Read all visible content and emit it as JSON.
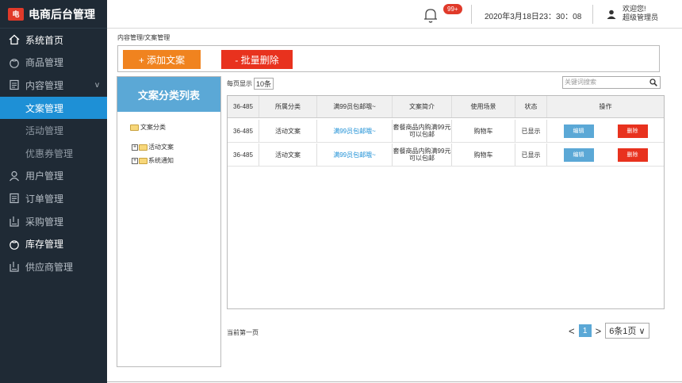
{
  "app": {
    "title": "电商后台管理",
    "logo_glyph": "电"
  },
  "sidebar": {
    "items": [
      {
        "label": "系统首页",
        "icon": "home-icon"
      },
      {
        "label": "商品管理",
        "icon": "gift-icon"
      },
      {
        "label": "内容管理",
        "icon": "document-icon"
      },
      {
        "label": "文案管理"
      },
      {
        "label": "活动管理"
      },
      {
        "label": "优惠券管理"
      },
      {
        "label": "用户管理",
        "icon": "user-icon"
      },
      {
        "label": "订单管理",
        "icon": "document-icon"
      },
      {
        "label": "采购管理",
        "icon": "clipboard-icon"
      },
      {
        "label": "库存管理",
        "icon": "gift-icon"
      },
      {
        "label": "供应商管理",
        "icon": "clipboard-icon"
      }
    ]
  },
  "header": {
    "badge": "99+",
    "datetime": "2020年3月18日23：30：08",
    "welcome_line1": "欢迎您!",
    "welcome_line2": "超级管理员"
  },
  "breadcrumb": "内容管理/文案管理",
  "toolbar": {
    "add_label": "+ 添加文案",
    "delete_label": "- 批量删除"
  },
  "tree": {
    "title": "文案分类列表",
    "root": "文案分类",
    "children": [
      "活动文案",
      "系统通知"
    ]
  },
  "list": {
    "page_size_prefix": "每页显示",
    "page_size_value": "10条",
    "search_placeholder": "关键词搜索",
    "headers": [
      "36-485",
      "所属分类",
      "满99员包邮哦~",
      "文案简介",
      "使用场景",
      "状态",
      "操作"
    ],
    "rows": [
      {
        "id": "36-485",
        "category": "活动文案",
        "title": "满99员包邮哦~",
        "intro": "套餐商品内购满99元可以包邮",
        "scene": "购物车",
        "status": "已显示",
        "edit": "编辑",
        "remove": "删除"
      },
      {
        "id": "36-485",
        "category": "活动文案",
        "title": "满99员包邮哦~",
        "intro": "套餐商品内购满99元可以包邮",
        "scene": "购物车",
        "status": "已显示",
        "edit": "编辑",
        "remove": "删除"
      }
    ]
  },
  "pagination": {
    "current_text": "当前第一页",
    "prev": "<",
    "current_page": "1",
    "next": ">",
    "summary": "6条1页",
    "dropdown_arrow": "∨"
  },
  "colors": {
    "sidebar": "#1f2a35",
    "active": "#1e90d6",
    "orange": "#f0831f",
    "red": "#e8321e",
    "blue": "#5ba8d6"
  }
}
